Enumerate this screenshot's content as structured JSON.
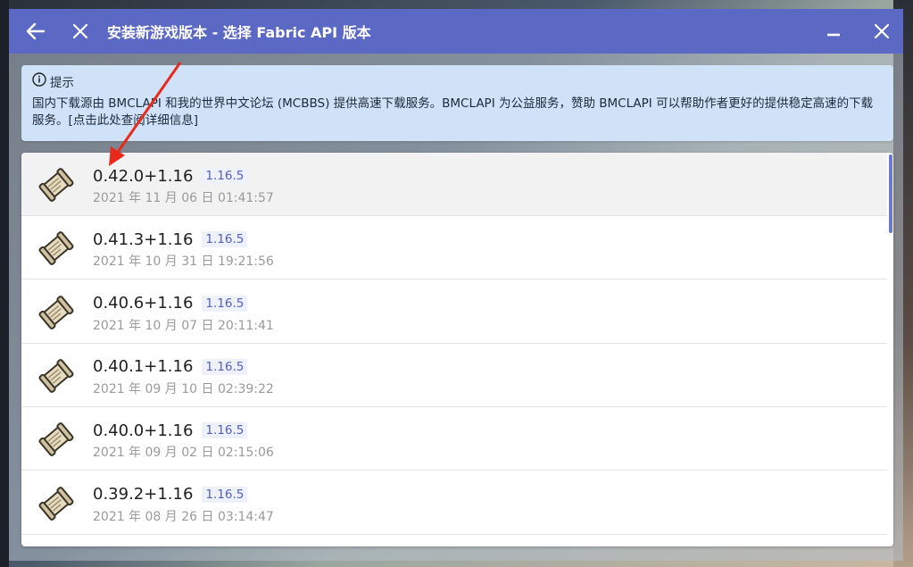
{
  "window": {
    "title": "安装新游戏版本 - 选择 Fabric API 版本",
    "back_icon": "back-arrow-icon",
    "close_icon": "close-icon",
    "minimize_icon": "minimize-icon",
    "accent_color": "#5b68c4"
  },
  "notice": {
    "icon": "info-icon",
    "title": "提示",
    "body": "国内下载源由 BMCLAPI 和我的世界中文论坛 (MCBBS) 提供高速下载服务。BMCLAPI 为公益服务，赞助 BMCLAPI 可以帮助作者更好的提供稳定高速的下载服务。[点击此处查阅详细信息]"
  },
  "versions": [
    {
      "version": "0.42.0+1.16",
      "mc": "1.16.5",
      "date": "2021 年 11 月 06 日 01:41:57"
    },
    {
      "version": "0.41.3+1.16",
      "mc": "1.16.5",
      "date": "2021 年 10 月 31 日 19:21:56"
    },
    {
      "version": "0.40.6+1.16",
      "mc": "1.16.5",
      "date": "2021 年 10 月 07 日 20:11:41"
    },
    {
      "version": "0.40.1+1.16",
      "mc": "1.16.5",
      "date": "2021 年 09 月 10 日 02:39:22"
    },
    {
      "version": "0.40.0+1.16",
      "mc": "1.16.5",
      "date": "2021 年 09 月 02 日 02:15:06"
    },
    {
      "version": "0.39.2+1.16",
      "mc": "1.16.5",
      "date": "2021 年 08 月 26 日 03:14:47"
    }
  ]
}
